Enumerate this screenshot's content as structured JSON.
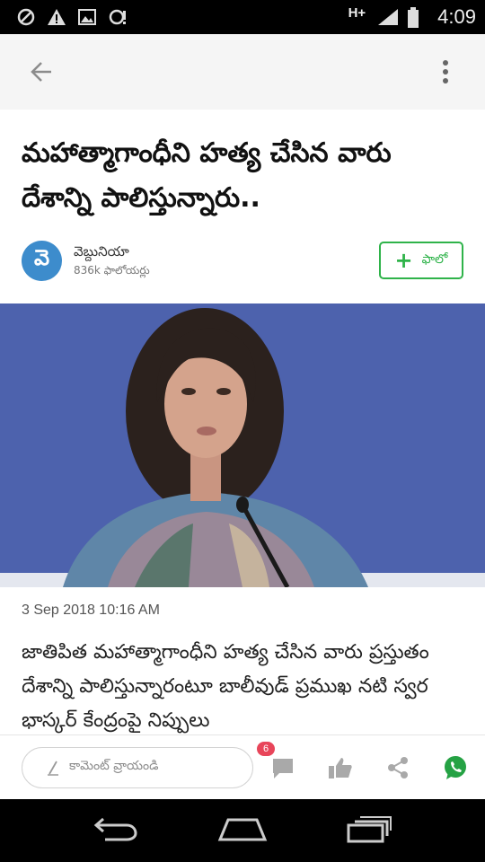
{
  "status_bar": {
    "network_type": "H+",
    "time": "4:09",
    "icons": [
      "blocked-icon",
      "warning-icon",
      "image-icon",
      "sync-icon",
      "signal-icon",
      "battery-icon"
    ]
  },
  "app_bar": {
    "back_icon": "arrow-left-icon",
    "menu_icon": "more-vertical-icon"
  },
  "article": {
    "headline": "మహాత్మాగాంధీని హత్య చేసిన వారు దేశాన్ని పాలిస్తున్నారు..",
    "publisher": {
      "avatar_letter": "వె",
      "name": "వెబ్దునియా",
      "followers": "836k ఫాలోయర్లు"
    },
    "follow_button": {
      "plus": "+",
      "label": "ఫాలో"
    },
    "date": "3 Sep 2018 10:16 AM",
    "body": "జాతిపిత మహాత్మాగాంధీని హత్య చేసిన వారు ప్రస్తుతం దేశాన్ని పాలిస్తున్నారంటూ బాలీవుడ్ ప్రముఖ నటి స్వర భాస్కర్ కేంద్రంపై నిప్పులు"
  },
  "action_bar": {
    "comment_placeholder": "కామెంట్ వ్రాయండి",
    "comment_count": "6",
    "icons": [
      "comment-icon",
      "like-icon",
      "share-icon",
      "whatsapp-icon"
    ]
  },
  "colors": {
    "accent_green": "#2fb34a",
    "avatar_blue": "#3d8ccc",
    "badge_red": "#e8455a",
    "whatsapp_green": "#25a244"
  }
}
